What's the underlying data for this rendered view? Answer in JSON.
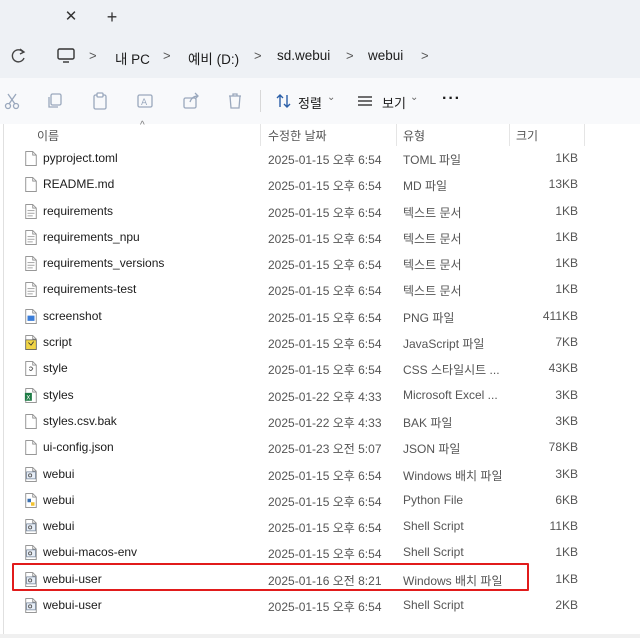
{
  "address": {
    "crumbs": [
      "내 PC",
      "예비 (D:)",
      "sd.webui",
      "webui"
    ]
  },
  "toolbar": {
    "sort_label": "정렬",
    "view_label": "보기"
  },
  "columns": {
    "name": "이름",
    "date": "수정한 날짜",
    "type": "유형",
    "size": "크기"
  },
  "files": [
    {
      "name": "pyproject.toml",
      "date": "2025-01-15 오후 6:54",
      "type": "TOML 파일",
      "size": "1KB",
      "icon": "document-icon"
    },
    {
      "name": "README.md",
      "date": "2025-01-15 오후 6:54",
      "type": "MD 파일",
      "size": "13KB",
      "icon": "document-icon"
    },
    {
      "name": "requirements",
      "date": "2025-01-15 오후 6:54",
      "type": "텍스트 문서",
      "size": "1KB",
      "icon": "text-document-icon"
    },
    {
      "name": "requirements_npu",
      "date": "2025-01-15 오후 6:54",
      "type": "텍스트 문서",
      "size": "1KB",
      "icon": "text-document-icon"
    },
    {
      "name": "requirements_versions",
      "date": "2025-01-15 오후 6:54",
      "type": "텍스트 문서",
      "size": "1KB",
      "icon": "text-document-icon"
    },
    {
      "name": "requirements-test",
      "date": "2025-01-15 오후 6:54",
      "type": "텍스트 문서",
      "size": "1KB",
      "icon": "text-document-icon"
    },
    {
      "name": "screenshot",
      "date": "2025-01-15 오후 6:54",
      "type": "PNG 파일",
      "size": "411KB",
      "icon": "image-file-icon"
    },
    {
      "name": "script",
      "date": "2025-01-15 오후 6:54",
      "type": "JavaScript 파일",
      "size": "7KB",
      "icon": "javascript-file-icon"
    },
    {
      "name": "style",
      "date": "2025-01-15 오후 6:54",
      "type": "CSS 스타일시트 ...",
      "size": "43KB",
      "icon": "css-file-icon"
    },
    {
      "name": "styles",
      "date": "2025-01-22 오후 4:33",
      "type": "Microsoft Excel ...",
      "size": "3KB",
      "icon": "excel-file-icon"
    },
    {
      "name": "styles.csv.bak",
      "date": "2025-01-22 오후 4:33",
      "type": "BAK 파일",
      "size": "3KB",
      "icon": "document-icon"
    },
    {
      "name": "ui-config.json",
      "date": "2025-01-23 오전 5:07",
      "type": "JSON 파일",
      "size": "78KB",
      "icon": "document-icon"
    },
    {
      "name": "webui",
      "date": "2025-01-15 오후 6:54",
      "type": "Windows 배치 파일",
      "size": "3KB",
      "icon": "batch-file-icon"
    },
    {
      "name": "webui",
      "date": "2025-01-15 오후 6:54",
      "type": "Python File",
      "size": "6KB",
      "icon": "python-file-icon"
    },
    {
      "name": "webui",
      "date": "2025-01-15 오후 6:54",
      "type": "Shell Script",
      "size": "11KB",
      "icon": "shell-script-icon"
    },
    {
      "name": "webui-macos-env",
      "date": "2025-01-15 오후 6:54",
      "type": "Shell Script",
      "size": "1KB",
      "icon": "shell-script-icon"
    },
    {
      "name": "webui-user",
      "date": "2025-01-16 오전 8:21",
      "type": "Windows 배치 파일",
      "size": "1KB",
      "icon": "batch-file-icon"
    },
    {
      "name": "webui-user",
      "date": "2025-01-15 오후 6:54",
      "type": "Shell Script",
      "size": "2KB",
      "icon": "shell-script-icon"
    }
  ],
  "highlight_color": "#e11b1b"
}
